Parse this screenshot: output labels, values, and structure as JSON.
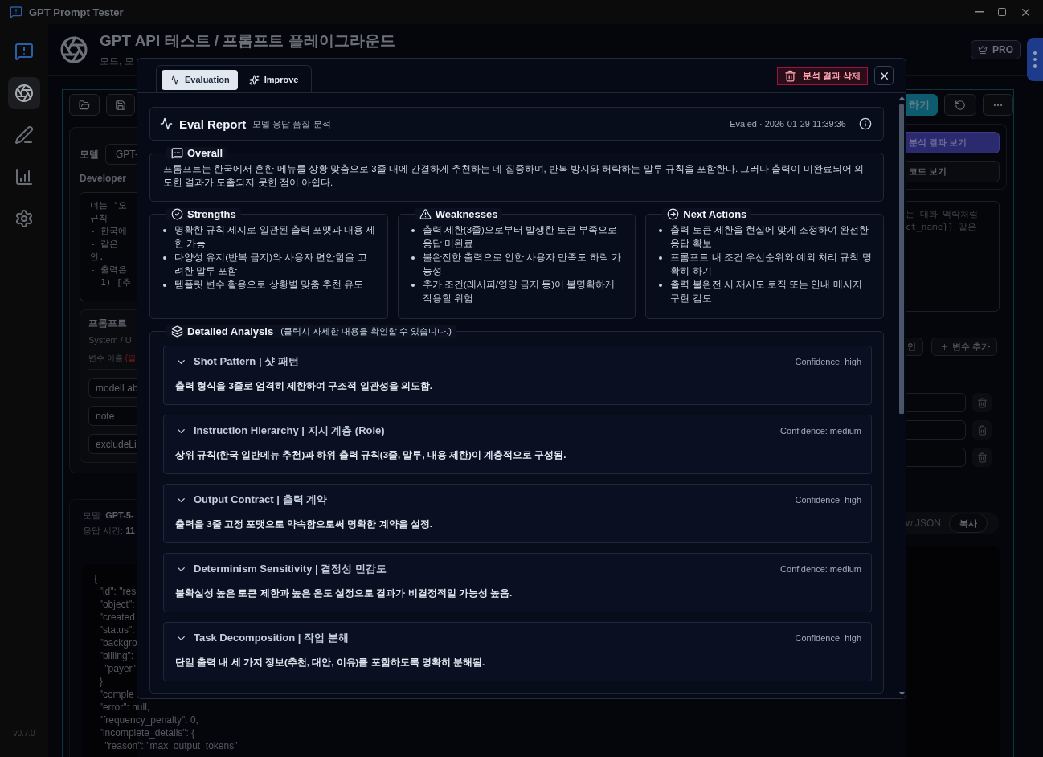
{
  "window": {
    "title": "GPT Prompt Tester",
    "version": "v0.7.0"
  },
  "sidebar": {
    "items": [
      {
        "kind": "app",
        "selected": false
      },
      {
        "kind": "model",
        "selected": true
      },
      {
        "kind": "edit",
        "selected": false
      },
      {
        "kind": "stats",
        "selected": false
      },
      {
        "kind": "settings",
        "selected": false
      }
    ]
  },
  "header": {
    "title": "GPT API 테스트 / 프롬프트 플레이그라운드",
    "subtitle": "모드, 모",
    "badge": "PRO"
  },
  "left_panel": {
    "model_label": "모델",
    "model_value": "GPT-",
    "developer_label": "Developer",
    "prompt_lines": [
      "너는 '오",
      "규칙",
      "- 한국에",
      "- 같은 ",
      "안.",
      "- 출력은",
      "  1) [추"
    ],
    "variables_title": "프롬프트",
    "variables_subtitle": "System / U",
    "variable_column": "변수 이름",
    "variable_required": "(필",
    "variables": [
      "modelLab",
      "note",
      "excludeLi"
    ],
    "result_model_label": "모델:",
    "result_model_value": "GPT-5-",
    "result_time_label": "응답 시간:",
    "result_time_value": "11",
    "json_lines": [
      "{",
      "  \"id\": \"res",
      "  \"object\":",
      "  \"created",
      "  \"status\":",
      "  \"backgro",
      "  \"billing\":",
      "    \"payer\"",
      "  },",
      "  \"comple",
      "  \"error\": null,",
      "  \"frequency_penalty\": 0,",
      "  \"incomplete_details\": {",
      "    \"reason\": \"max_output_tokens\""
    ]
  },
  "right_panel": {
    "run_button": "하기",
    "analysis_button": "분석 결과 보기",
    "code_button": "코드 보기",
    "prompt_lines": [
      "는 대화 맥락처럼",
      "ct_name}} 같은"
    ],
    "confirm_button": "인",
    "add_variable_button": "변수 추가",
    "raw_json_label": "w JSON",
    "copy_button": "복사"
  },
  "modal": {
    "tabs": [
      {
        "kind": "evaluation",
        "label": "Evaluation",
        "selected": true
      },
      {
        "kind": "improve",
        "label": "Improve",
        "selected": false
      }
    ],
    "delete_button": "분석 결과 삭제",
    "report": {
      "title": "Eval Report",
      "subtitle": "모델 응답 품질 분석",
      "evaled": "Evaled · 2026-01-29 11:39:36"
    },
    "overall": {
      "title": "Overall",
      "text": "프롬프트는 한국에서 흔한 메뉴를 상황 맞춤으로 3줄 내에 간결하게 추천하는 데 집중하며, 반복 방지와 허락하는 말투 규칙을 포함한다. 그러나 출력이 미완료되어 의도한 결과가 도출되지 못한 점이 아쉽다."
    },
    "sections": [
      {
        "kind": "strengths",
        "title": "Strengths",
        "items": [
          "명확한 규칙 제시로 일관된 출력 포맷과 내용 제한 가능",
          "다양성 유지(반복 금지)와 사용자 편안함을 고려한 말투 포함",
          "템플릿 변수 활용으로 상황별 맞춤 추천 유도"
        ]
      },
      {
        "kind": "weaknesses",
        "title": "Weaknesses",
        "items": [
          "출력 제한(3줄)으로부터 발생한 토큰 부족으로 응답 미완료",
          "불완전한 출력으로 인한 사용자 만족도 하락 가능성",
          "추가 조건(레시피/영양 금지 등)이 불명확하게 작용할 위험"
        ]
      },
      {
        "kind": "next",
        "title": "Next Actions",
        "items": [
          "출력 토큰 제한을 현실에 맞게 조정하여 완전한 응답 확보",
          "프롬프트 내 조건 우선순위와 예외 처리 규칙 명확히 하기",
          "출력 불완전 시 재시도 로직 또는 안내 메시지 구현 검토"
        ]
      }
    ],
    "detailed": {
      "title": "Detailed Analysis",
      "hint": "(클릭시 자세한 내용을 확인할 수 있습니다.)",
      "items": [
        {
          "title": "Shot Pattern | 샷 패턴",
          "confidence": "Confidence: high",
          "expanded": true,
          "description": "출력 형식을 3줄로 엄격히 제한하여 구조적 일관성을 의도함."
        },
        {
          "title": "Instruction Hierarchy | 지시 계층 (Role)",
          "confidence": "Confidence: medium",
          "expanded": true,
          "description": "상위 규칙(한국 일반메뉴 추천)과 하위 출력 규칙(3줄, 말투, 내용 제한)이 계층적으로 구성됨."
        },
        {
          "title": "Output Contract | 출력 계약",
          "confidence": "Confidence: high",
          "expanded": true,
          "description": "출력을 3줄 고정 포맷으로 약속함으로써 명확한 계약을 설정."
        },
        {
          "title": "Determinism Sensitivity | 결정성 민감도",
          "confidence": "Confidence: medium",
          "expanded": true,
          "description": "불확실성 높은 토큰 제한과 높은 온도 설정으로 결과가 비결정적일 가능성 높음."
        },
        {
          "title": "Task Decomposition | 작업 분해",
          "confidence": "Confidence: high",
          "expanded": true,
          "description": "단일 출력 내 세 가지 정보(추천, 대안, 이유)를 포함하도록 명확히 분해됨."
        }
      ]
    }
  }
}
